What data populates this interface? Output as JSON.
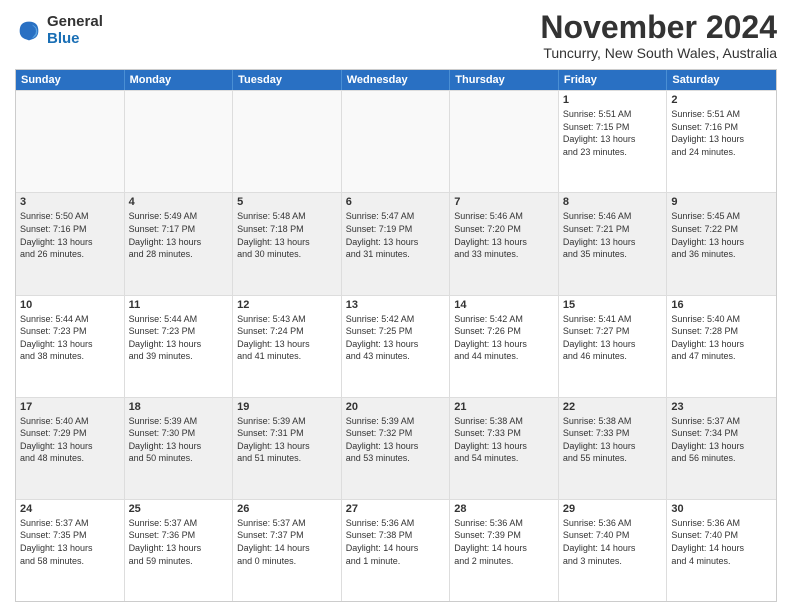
{
  "logo": {
    "general": "General",
    "blue": "Blue"
  },
  "title": "November 2024",
  "location": "Tuncurry, New South Wales, Australia",
  "weekdays": [
    "Sunday",
    "Monday",
    "Tuesday",
    "Wednesday",
    "Thursday",
    "Friday",
    "Saturday"
  ],
  "rows": [
    [
      {
        "day": "",
        "info": "",
        "empty": true
      },
      {
        "day": "",
        "info": "",
        "empty": true
      },
      {
        "day": "",
        "info": "",
        "empty": true
      },
      {
        "day": "",
        "info": "",
        "empty": true
      },
      {
        "day": "",
        "info": "",
        "empty": true
      },
      {
        "day": "1",
        "info": "Sunrise: 5:51 AM\nSunset: 7:15 PM\nDaylight: 13 hours\nand 23 minutes.",
        "empty": false
      },
      {
        "day": "2",
        "info": "Sunrise: 5:51 AM\nSunset: 7:16 PM\nDaylight: 13 hours\nand 24 minutes.",
        "empty": false
      }
    ],
    [
      {
        "day": "3",
        "info": "Sunrise: 5:50 AM\nSunset: 7:16 PM\nDaylight: 13 hours\nand 26 minutes.",
        "empty": false
      },
      {
        "day": "4",
        "info": "Sunrise: 5:49 AM\nSunset: 7:17 PM\nDaylight: 13 hours\nand 28 minutes.",
        "empty": false
      },
      {
        "day": "5",
        "info": "Sunrise: 5:48 AM\nSunset: 7:18 PM\nDaylight: 13 hours\nand 30 minutes.",
        "empty": false
      },
      {
        "day": "6",
        "info": "Sunrise: 5:47 AM\nSunset: 7:19 PM\nDaylight: 13 hours\nand 31 minutes.",
        "empty": false
      },
      {
        "day": "7",
        "info": "Sunrise: 5:46 AM\nSunset: 7:20 PM\nDaylight: 13 hours\nand 33 minutes.",
        "empty": false
      },
      {
        "day": "8",
        "info": "Sunrise: 5:46 AM\nSunset: 7:21 PM\nDaylight: 13 hours\nand 35 minutes.",
        "empty": false
      },
      {
        "day": "9",
        "info": "Sunrise: 5:45 AM\nSunset: 7:22 PM\nDaylight: 13 hours\nand 36 minutes.",
        "empty": false
      }
    ],
    [
      {
        "day": "10",
        "info": "Sunrise: 5:44 AM\nSunset: 7:23 PM\nDaylight: 13 hours\nand 38 minutes.",
        "empty": false
      },
      {
        "day": "11",
        "info": "Sunrise: 5:44 AM\nSunset: 7:23 PM\nDaylight: 13 hours\nand 39 minutes.",
        "empty": false
      },
      {
        "day": "12",
        "info": "Sunrise: 5:43 AM\nSunset: 7:24 PM\nDaylight: 13 hours\nand 41 minutes.",
        "empty": false
      },
      {
        "day": "13",
        "info": "Sunrise: 5:42 AM\nSunset: 7:25 PM\nDaylight: 13 hours\nand 43 minutes.",
        "empty": false
      },
      {
        "day": "14",
        "info": "Sunrise: 5:42 AM\nSunset: 7:26 PM\nDaylight: 13 hours\nand 44 minutes.",
        "empty": false
      },
      {
        "day": "15",
        "info": "Sunrise: 5:41 AM\nSunset: 7:27 PM\nDaylight: 13 hours\nand 46 minutes.",
        "empty": false
      },
      {
        "day": "16",
        "info": "Sunrise: 5:40 AM\nSunset: 7:28 PM\nDaylight: 13 hours\nand 47 minutes.",
        "empty": false
      }
    ],
    [
      {
        "day": "17",
        "info": "Sunrise: 5:40 AM\nSunset: 7:29 PM\nDaylight: 13 hours\nand 48 minutes.",
        "empty": false
      },
      {
        "day": "18",
        "info": "Sunrise: 5:39 AM\nSunset: 7:30 PM\nDaylight: 13 hours\nand 50 minutes.",
        "empty": false
      },
      {
        "day": "19",
        "info": "Sunrise: 5:39 AM\nSunset: 7:31 PM\nDaylight: 13 hours\nand 51 minutes.",
        "empty": false
      },
      {
        "day": "20",
        "info": "Sunrise: 5:39 AM\nSunset: 7:32 PM\nDaylight: 13 hours\nand 53 minutes.",
        "empty": false
      },
      {
        "day": "21",
        "info": "Sunrise: 5:38 AM\nSunset: 7:33 PM\nDaylight: 13 hours\nand 54 minutes.",
        "empty": false
      },
      {
        "day": "22",
        "info": "Sunrise: 5:38 AM\nSunset: 7:33 PM\nDaylight: 13 hours\nand 55 minutes.",
        "empty": false
      },
      {
        "day": "23",
        "info": "Sunrise: 5:37 AM\nSunset: 7:34 PM\nDaylight: 13 hours\nand 56 minutes.",
        "empty": false
      }
    ],
    [
      {
        "day": "24",
        "info": "Sunrise: 5:37 AM\nSunset: 7:35 PM\nDaylight: 13 hours\nand 58 minutes.",
        "empty": false
      },
      {
        "day": "25",
        "info": "Sunrise: 5:37 AM\nSunset: 7:36 PM\nDaylight: 13 hours\nand 59 minutes.",
        "empty": false
      },
      {
        "day": "26",
        "info": "Sunrise: 5:37 AM\nSunset: 7:37 PM\nDaylight: 14 hours\nand 0 minutes.",
        "empty": false
      },
      {
        "day": "27",
        "info": "Sunrise: 5:36 AM\nSunset: 7:38 PM\nDaylight: 14 hours\nand 1 minute.",
        "empty": false
      },
      {
        "day": "28",
        "info": "Sunrise: 5:36 AM\nSunset: 7:39 PM\nDaylight: 14 hours\nand 2 minutes.",
        "empty": false
      },
      {
        "day": "29",
        "info": "Sunrise: 5:36 AM\nSunset: 7:40 PM\nDaylight: 14 hours\nand 3 minutes.",
        "empty": false
      },
      {
        "day": "30",
        "info": "Sunrise: 5:36 AM\nSunset: 7:40 PM\nDaylight: 14 hours\nand 4 minutes.",
        "empty": false
      }
    ]
  ]
}
